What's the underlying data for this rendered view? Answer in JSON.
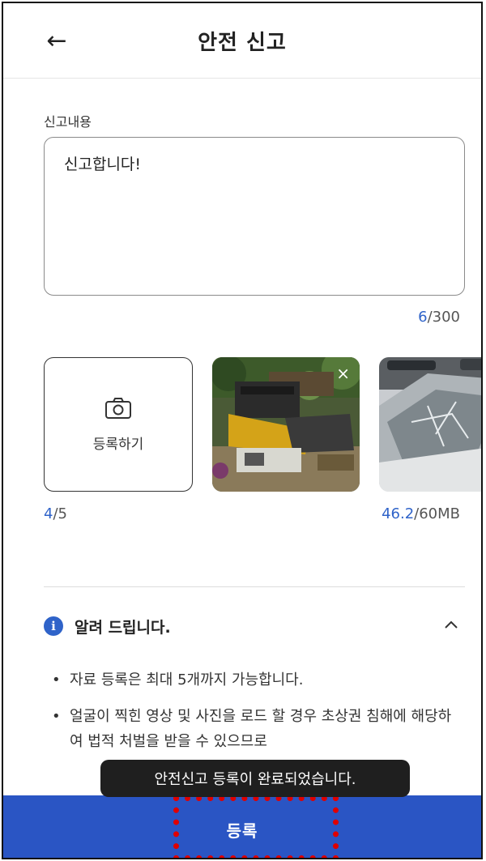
{
  "header": {
    "title": "안전 신고",
    "back_icon": "arrow-left-icon"
  },
  "form": {
    "label": "신고내용",
    "content": "신고합니다!",
    "char_count": "6",
    "char_max": "/300"
  },
  "photos": {
    "add_label": "등록하기",
    "count": "4",
    "count_max": "/5",
    "size": "46.2",
    "size_max": "/60MB",
    "items": [
      {
        "alt": "construction-site-photo"
      },
      {
        "alt": "damaged-car-windshield-photo"
      }
    ],
    "remove_icon": "×"
  },
  "notice": {
    "title": "알려 드립니다.",
    "bullets": [
      "자료 등록은 최대 5개까지 가능합니다.",
      "얼굴이 찍힌 영상 및 사진을 로드 할 경우 초상권 침해에 해당하여 법적 처벌을 받을 수 있으므로"
    ]
  },
  "toast": {
    "message": "안전신고 등록이 완료되었습니다."
  },
  "submit": {
    "label": "등록"
  },
  "colors": {
    "accent": "#2f63c9",
    "submit_bg": "#2a55c4",
    "highlight": "#e00000"
  }
}
